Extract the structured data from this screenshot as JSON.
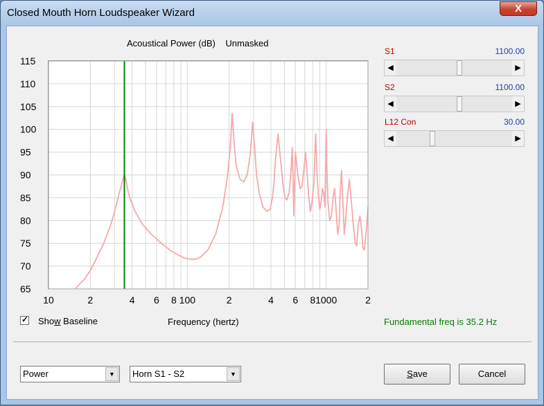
{
  "window": {
    "title": "Closed Mouth Horn Loudspeaker Wizard",
    "close_glyph": "X"
  },
  "chart": {
    "title": "Acoustical Power (dB)",
    "subtitle": "Unmasked",
    "xlabel": "Frequency (hertz)"
  },
  "chart_data": {
    "type": "line",
    "title": "Acoustical Power (dB)  Unmasked",
    "xlabel": "Frequency (hertz)",
    "ylabel": "",
    "x_scale": "log",
    "xlim": [
      10,
      2000
    ],
    "ylim": [
      65,
      115
    ],
    "y_ticks": [
      115,
      110,
      105,
      100,
      95,
      90,
      85,
      80,
      75,
      70,
      65
    ],
    "x_tick_labels": [
      "10",
      "2",
      "4",
      "6",
      "8",
      "100",
      "2",
      "4",
      "6",
      "8",
      "1000",
      "2"
    ],
    "grid": true,
    "marker_line": {
      "x": 35.2,
      "color": "#008000"
    },
    "series": [
      {
        "color": "#f4a9a9",
        "x": [
          15.5,
          18,
          20,
          22,
          25,
          28,
          30,
          32,
          34,
          35.2,
          36,
          38,
          42,
          48,
          55,
          65,
          75,
          85,
          95,
          105,
          115,
          125,
          140,
          160,
          180,
          195,
          205,
          210,
          213,
          217,
          225,
          240,
          255,
          270,
          285,
          295,
          305,
          315,
          330,
          350,
          375,
          395,
          410,
          420,
          430,
          450,
          470,
          490,
          505,
          520,
          540,
          555,
          570,
          585,
          600,
          625,
          650,
          670,
          690,
          710,
          730,
          750,
          770,
          790,
          815,
          840,
          860,
          880,
          900,
          920,
          940,
          960,
          980,
          1000,
          1010,
          1030,
          1060,
          1090,
          1120,
          1150,
          1180,
          1210,
          1240,
          1260,
          1290,
          1320,
          1350,
          1380,
          1420,
          1470,
          1520,
          1570,
          1620,
          1660,
          1700,
          1750,
          1800,
          1840,
          1880,
          1920,
          1960,
          2000
        ],
        "y": [
          65,
          67,
          69,
          71.5,
          75,
          79,
          82,
          85.5,
          88.5,
          90.2,
          89,
          85.5,
          82,
          79,
          77,
          75,
          73.5,
          72.5,
          71.8,
          71.5,
          71.5,
          72,
          73.5,
          77,
          83,
          90,
          97,
          103.5,
          101,
          97,
          92,
          89,
          88.5,
          90,
          95,
          101.5,
          96,
          90,
          86,
          83,
          82,
          82.5,
          85,
          88,
          93,
          99,
          93,
          87.5,
          85,
          84.5,
          86,
          90,
          96,
          81,
          95,
          90,
          87,
          87.5,
          91,
          95,
          90,
          85,
          82,
          84,
          88,
          99,
          90,
          85,
          82.5,
          84,
          87,
          86,
          83,
          100,
          92,
          84,
          80,
          81,
          85,
          87,
          82,
          77,
          79,
          86,
          91,
          84,
          77,
          80,
          85,
          89,
          84,
          79,
          75,
          74.5,
          79,
          81,
          78,
          74,
          73.5,
          76,
          79,
          83
        ]
      }
    ]
  },
  "checkbox": {
    "label_pre": "Sho",
    "label_access": "w",
    "label_post": " Baseline",
    "checked": true,
    "mark": "✓"
  },
  "status": {
    "text": "Fundamental freq is 35.2 Hz",
    "color": "#008000"
  },
  "sliders": [
    {
      "label": "S1",
      "value": "1100.00",
      "fraction": 0.55
    },
    {
      "label": "S2",
      "value": "1100.00",
      "fraction": 0.55
    },
    {
      "label": "L12  Con",
      "value": "30.00",
      "fraction": 0.3
    }
  ],
  "arrows": {
    "left": "◀",
    "right": "▶",
    "down": "▼"
  },
  "combos": [
    {
      "value": "Power"
    },
    {
      "value": "Horn S1 - S2"
    }
  ],
  "buttons": {
    "save_access": "S",
    "save_rest": "ave",
    "cancel": "Cancel"
  }
}
